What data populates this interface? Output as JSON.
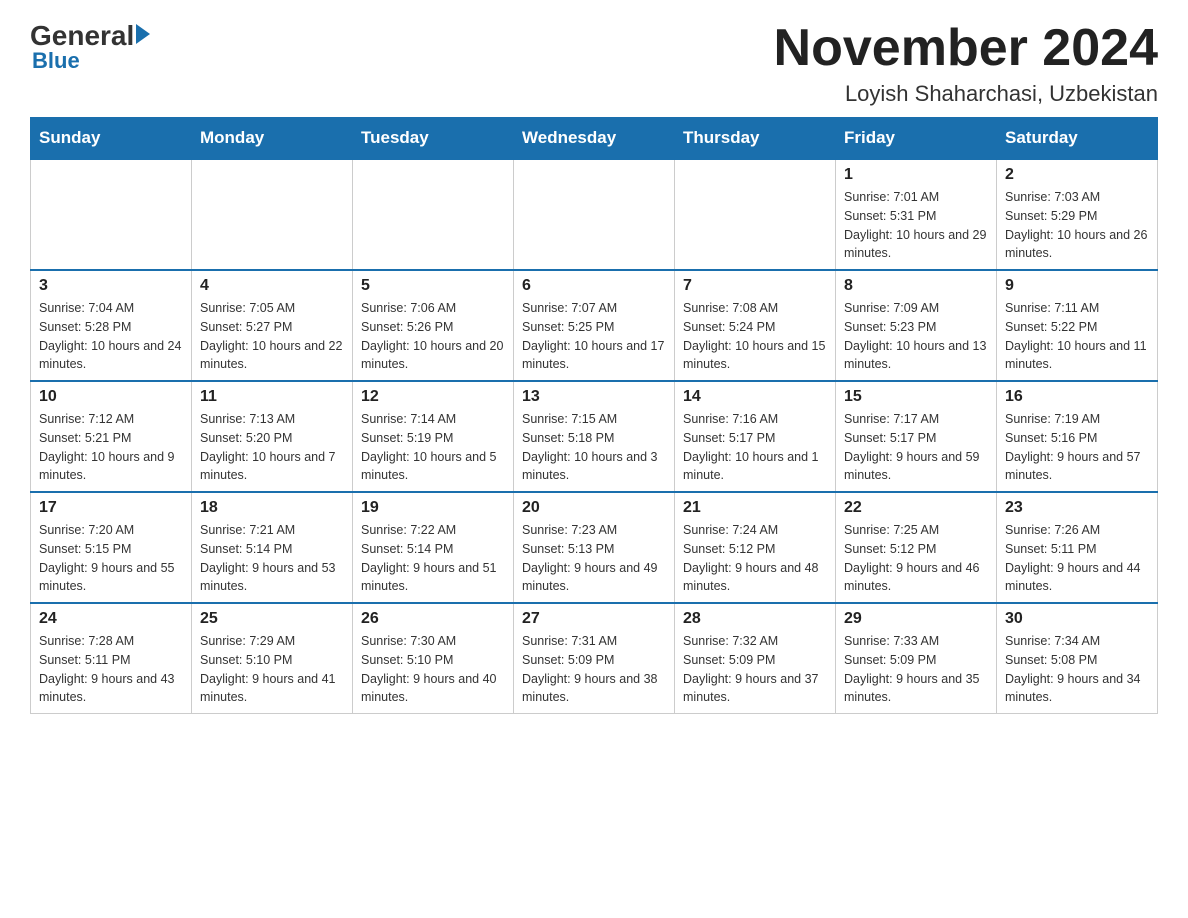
{
  "logo": {
    "general": "General",
    "blue": "Blue"
  },
  "header": {
    "month": "November 2024",
    "location": "Loyish Shaharchasi, Uzbekistan"
  },
  "weekdays": [
    "Sunday",
    "Monday",
    "Tuesday",
    "Wednesday",
    "Thursday",
    "Friday",
    "Saturday"
  ],
  "weeks": [
    [
      {
        "day": "",
        "info": ""
      },
      {
        "day": "",
        "info": ""
      },
      {
        "day": "",
        "info": ""
      },
      {
        "day": "",
        "info": ""
      },
      {
        "day": "",
        "info": ""
      },
      {
        "day": "1",
        "info": "Sunrise: 7:01 AM\nSunset: 5:31 PM\nDaylight: 10 hours and 29 minutes."
      },
      {
        "day": "2",
        "info": "Sunrise: 7:03 AM\nSunset: 5:29 PM\nDaylight: 10 hours and 26 minutes."
      }
    ],
    [
      {
        "day": "3",
        "info": "Sunrise: 7:04 AM\nSunset: 5:28 PM\nDaylight: 10 hours and 24 minutes."
      },
      {
        "day": "4",
        "info": "Sunrise: 7:05 AM\nSunset: 5:27 PM\nDaylight: 10 hours and 22 minutes."
      },
      {
        "day": "5",
        "info": "Sunrise: 7:06 AM\nSunset: 5:26 PM\nDaylight: 10 hours and 20 minutes."
      },
      {
        "day": "6",
        "info": "Sunrise: 7:07 AM\nSunset: 5:25 PM\nDaylight: 10 hours and 17 minutes."
      },
      {
        "day": "7",
        "info": "Sunrise: 7:08 AM\nSunset: 5:24 PM\nDaylight: 10 hours and 15 minutes."
      },
      {
        "day": "8",
        "info": "Sunrise: 7:09 AM\nSunset: 5:23 PM\nDaylight: 10 hours and 13 minutes."
      },
      {
        "day": "9",
        "info": "Sunrise: 7:11 AM\nSunset: 5:22 PM\nDaylight: 10 hours and 11 minutes."
      }
    ],
    [
      {
        "day": "10",
        "info": "Sunrise: 7:12 AM\nSunset: 5:21 PM\nDaylight: 10 hours and 9 minutes."
      },
      {
        "day": "11",
        "info": "Sunrise: 7:13 AM\nSunset: 5:20 PM\nDaylight: 10 hours and 7 minutes."
      },
      {
        "day": "12",
        "info": "Sunrise: 7:14 AM\nSunset: 5:19 PM\nDaylight: 10 hours and 5 minutes."
      },
      {
        "day": "13",
        "info": "Sunrise: 7:15 AM\nSunset: 5:18 PM\nDaylight: 10 hours and 3 minutes."
      },
      {
        "day": "14",
        "info": "Sunrise: 7:16 AM\nSunset: 5:17 PM\nDaylight: 10 hours and 1 minute."
      },
      {
        "day": "15",
        "info": "Sunrise: 7:17 AM\nSunset: 5:17 PM\nDaylight: 9 hours and 59 minutes."
      },
      {
        "day": "16",
        "info": "Sunrise: 7:19 AM\nSunset: 5:16 PM\nDaylight: 9 hours and 57 minutes."
      }
    ],
    [
      {
        "day": "17",
        "info": "Sunrise: 7:20 AM\nSunset: 5:15 PM\nDaylight: 9 hours and 55 minutes."
      },
      {
        "day": "18",
        "info": "Sunrise: 7:21 AM\nSunset: 5:14 PM\nDaylight: 9 hours and 53 minutes."
      },
      {
        "day": "19",
        "info": "Sunrise: 7:22 AM\nSunset: 5:14 PM\nDaylight: 9 hours and 51 minutes."
      },
      {
        "day": "20",
        "info": "Sunrise: 7:23 AM\nSunset: 5:13 PM\nDaylight: 9 hours and 49 minutes."
      },
      {
        "day": "21",
        "info": "Sunrise: 7:24 AM\nSunset: 5:12 PM\nDaylight: 9 hours and 48 minutes."
      },
      {
        "day": "22",
        "info": "Sunrise: 7:25 AM\nSunset: 5:12 PM\nDaylight: 9 hours and 46 minutes."
      },
      {
        "day": "23",
        "info": "Sunrise: 7:26 AM\nSunset: 5:11 PM\nDaylight: 9 hours and 44 minutes."
      }
    ],
    [
      {
        "day": "24",
        "info": "Sunrise: 7:28 AM\nSunset: 5:11 PM\nDaylight: 9 hours and 43 minutes."
      },
      {
        "day": "25",
        "info": "Sunrise: 7:29 AM\nSunset: 5:10 PM\nDaylight: 9 hours and 41 minutes."
      },
      {
        "day": "26",
        "info": "Sunrise: 7:30 AM\nSunset: 5:10 PM\nDaylight: 9 hours and 40 minutes."
      },
      {
        "day": "27",
        "info": "Sunrise: 7:31 AM\nSunset: 5:09 PM\nDaylight: 9 hours and 38 minutes."
      },
      {
        "day": "28",
        "info": "Sunrise: 7:32 AM\nSunset: 5:09 PM\nDaylight: 9 hours and 37 minutes."
      },
      {
        "day": "29",
        "info": "Sunrise: 7:33 AM\nSunset: 5:09 PM\nDaylight: 9 hours and 35 minutes."
      },
      {
        "day": "30",
        "info": "Sunrise: 7:34 AM\nSunset: 5:08 PM\nDaylight: 9 hours and 34 minutes."
      }
    ]
  ]
}
